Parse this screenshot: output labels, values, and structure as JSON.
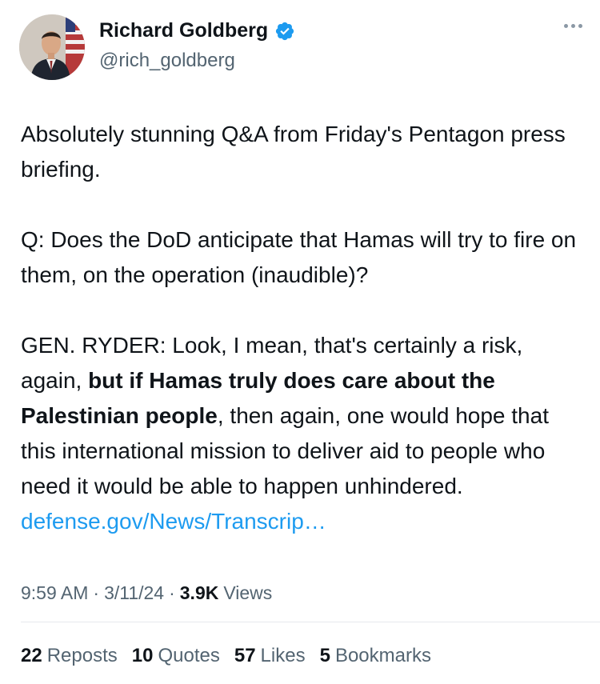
{
  "author": {
    "name": "Richard Goldberg",
    "handle": "@rich_goldberg",
    "verified": true,
    "verified_color": "#1d9bf0"
  },
  "tweet": {
    "paragraphs": [
      [
        {
          "text": "Absolutely stunning Q&A from Friday's Pentagon press briefing.",
          "style": "normal"
        }
      ],
      [
        {
          "text": "Q: Does the DoD anticipate that Hamas will try to fire on them, on the operation (inaudible)?",
          "style": "normal"
        }
      ],
      [
        {
          "text": "GEN. RYDER: Look, I mean, that's certainly a risk, again, ",
          "style": "normal"
        },
        {
          "text": "but if Hamas truly does care about the Palestinian people",
          "style": "bold"
        },
        {
          "text": ", then again, one would hope that this international mission to deliver aid to people who need it would be able to happen unhindered. ",
          "style": "normal"
        },
        {
          "text": "defense.gov/News/Transcrip…",
          "style": "link"
        }
      ]
    ]
  },
  "meta": {
    "time": "9:59 AM",
    "date": "3/11/24",
    "views_count": "3.9K",
    "views_label": "Views",
    "separator": "·"
  },
  "stats": [
    {
      "count": "22",
      "label": "Reposts"
    },
    {
      "count": "10",
      "label": "Quotes"
    },
    {
      "count": "57",
      "label": "Likes"
    },
    {
      "count": "5",
      "label": "Bookmarks"
    }
  ],
  "colors": {
    "text": "#0f1419",
    "secondary": "#536471",
    "link": "#1d9bf0"
  }
}
